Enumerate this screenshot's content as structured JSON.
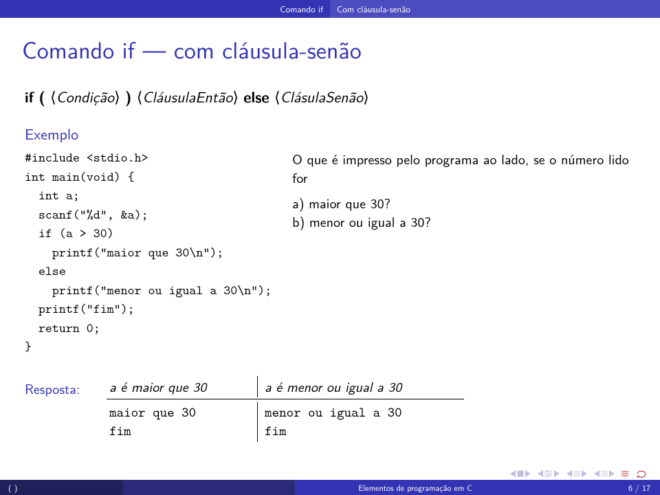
{
  "headline": {
    "left": "Comando if",
    "right": "Com cláusula-senão"
  },
  "title": "Comando if — com cláusula-senão",
  "syntax": {
    "if": "if",
    "open": "(",
    "cond": "Condição",
    "close": ")",
    "then": "CláusulaEntão",
    "else": "else",
    "elseClause": "ClásulaSenão"
  },
  "example": {
    "heading": "Exemplo",
    "code": "#include <stdio.h>\nint main(void) {\n  int a;\n  scanf(\"%d\", &a);\n  if (a > 30)\n    printf(\"maior que 30\\n\");\n  else\n    printf(\"menor ou igual a 30\\n\");\n  printf(\"fim\");\n  return 0;\n}",
    "question_intro": "O que é impresso pelo programa ao lado, se o número lido for",
    "opt_a": "a) maior que 30?",
    "opt_b": "b) menor ou igual a 30?"
  },
  "answer": {
    "label": "Resposta:",
    "h1_prefix": "a",
    "h1_rest": " é maior que 30",
    "h2_prefix": "a",
    "h2_rest": " é menor ou igual a 30",
    "c1l1": "maior que 30",
    "c1l2": "fim",
    "c2l1": "menor ou igual a 30",
    "c2l2": "fim"
  },
  "footer": {
    "author": "( )",
    "title": "Elementos de programação em C",
    "page": "6 / 17"
  }
}
